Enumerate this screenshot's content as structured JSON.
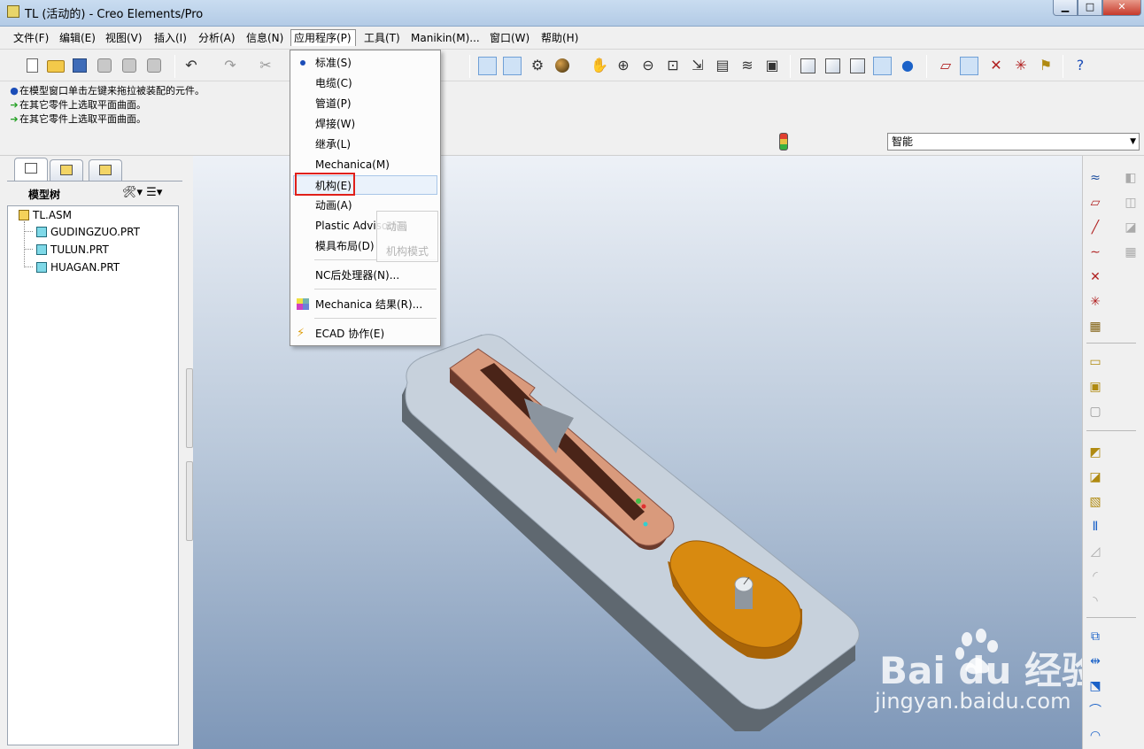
{
  "window": {
    "title": "TL (活动的) - Creo Elements/Pro",
    "controls": {
      "minimize": "▁",
      "maximize": "□",
      "close": "✕"
    }
  },
  "menubar": {
    "items": [
      "文件(F)",
      "编辑(E)",
      "视图(V)",
      "插入(I)",
      "分析(A)",
      "信息(N)",
      "应用程序(P)",
      "工具(T)",
      "Manikin(M)...",
      "窗口(W)",
      "帮助(H)"
    ],
    "active": "应用程序(P)"
  },
  "dropdown": {
    "items": [
      {
        "label": "标准(S)",
        "selected": true
      },
      {
        "label": "电缆(C)"
      },
      {
        "label": "管道(P)"
      },
      {
        "label": "焊接(W)"
      },
      {
        "label": "继承(L)"
      },
      {
        "label": "Mechanica(M)"
      },
      {
        "label": "机构(E)",
        "highlighted": true
      },
      {
        "label": "动画(A)"
      },
      {
        "label": "Plastic Advisor(T)"
      },
      {
        "label": "模具布局(D)"
      },
      {
        "label": "NC后处理器(N)..."
      },
      {
        "label": "Mechanica 结果(R)..."
      },
      {
        "label": "ECAD 协作(E)"
      }
    ],
    "submenu_ghost": [
      "动画",
      "机构模式"
    ]
  },
  "messages": [
    {
      "icon": "info-bullet-icon",
      "text": "在模型窗口单击左键来拖拉被装配的元件。"
    },
    {
      "icon": "green-arrow-icon",
      "text": "在其它零件上选取平面曲面。"
    },
    {
      "icon": "green-arrow-icon",
      "text": "在其它零件上选取平面曲面。"
    }
  ],
  "filter": {
    "value": "智能"
  },
  "model_tree": {
    "header": "模型树",
    "root": "TL.ASM",
    "children": [
      "GUDINGZUO.PRT",
      "TULUN.PRT",
      "HUAGAN.PRT"
    ]
  },
  "watermark": {
    "main": "Bai  du 经验",
    "sub": "jingyan.baidu.com"
  },
  "colors": {
    "highlight_border": "#e0201a",
    "base_plate": "#c5d0dc",
    "slider": "#d99a7c",
    "cam": "#d88a10"
  }
}
